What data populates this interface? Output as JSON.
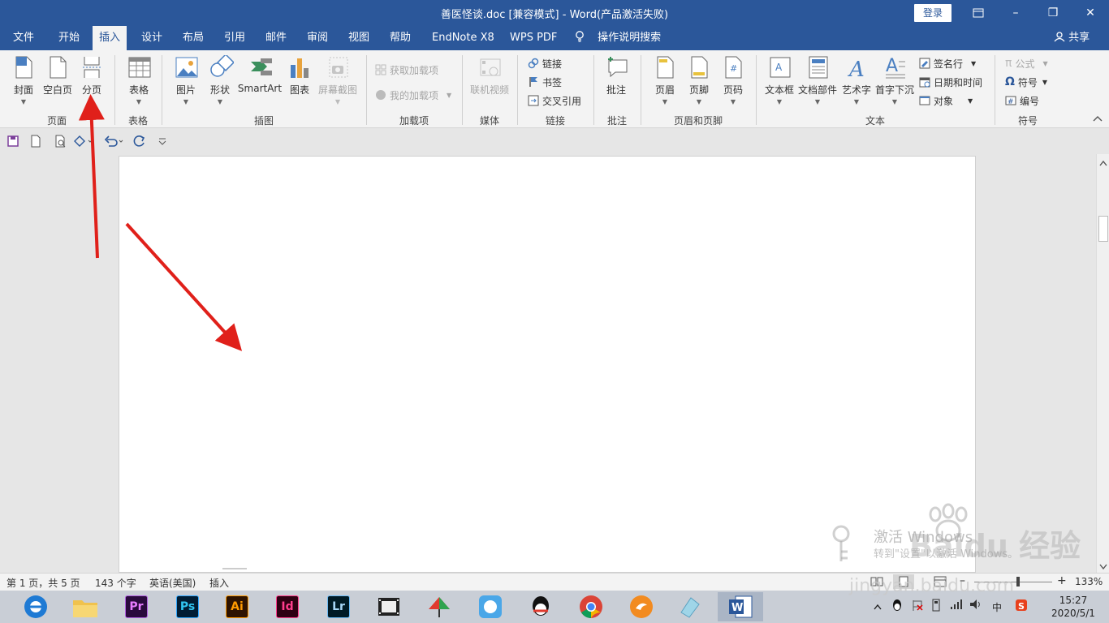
{
  "titlebar": {
    "title": "善医怪谈.doc [兼容模式]  -  Word(产品激活失败)",
    "login": "登录",
    "ribbon_display_icon": "ribbon-display-icon",
    "minimize": "–",
    "restore": "❐",
    "close": "✕"
  },
  "menu": {
    "tabs": [
      "文件",
      "开始",
      "插入",
      "设计",
      "布局",
      "引用",
      "邮件",
      "审阅",
      "视图",
      "帮助",
      "EndNote X8",
      "WPS PDF"
    ],
    "active": "插入",
    "search": "操作说明搜索",
    "share": "共享"
  },
  "ribbon": {
    "pages": {
      "cover": "封面",
      "blank": "空白页",
      "break": "分页",
      "label": "页面"
    },
    "tables": {
      "table": "表格",
      "label": "表格"
    },
    "illustrations": {
      "picture": "图片",
      "shapes": "形状",
      "smartart": "SmartArt",
      "chart": "图表",
      "screenshot": "屏幕截图",
      "label": "插图"
    },
    "addins": {
      "get": "获取加载项",
      "mine": "我的加载项",
      "label": "加载项"
    },
    "media": {
      "video": "联机视频",
      "label": "媒体"
    },
    "links": {
      "link": "链接",
      "bookmark": "书签",
      "crossref": "交叉引用",
      "label": "链接"
    },
    "comments": {
      "comment": "批注",
      "label": "批注"
    },
    "header_footer": {
      "header": "页眉",
      "footer": "页脚",
      "page_number": "页码",
      "label": "页眉和页脚"
    },
    "text": {
      "textbox": "文本框",
      "quickparts": "文档部件",
      "wordart": "艺术字",
      "dropcap": "首字下沉",
      "signature": "签名行",
      "datetime": "日期和时间",
      "object": "对象",
      "label": "文本"
    },
    "symbols": {
      "equation": "公式",
      "symbol": "符号",
      "number": "编号",
      "label": "符号"
    }
  },
  "statusbar": {
    "page": "第 1 页，共 5 页",
    "words": "143 个字",
    "language": "英语(美国)",
    "mode": "插入",
    "zoom": "133%"
  },
  "taskbar": {
    "apps": [
      "Pr",
      "Ps",
      "Ai",
      "Id",
      "Lr"
    ],
    "ime": "中",
    "time": "15:27",
    "date": "2020/5/1"
  },
  "watermark": {
    "activate": "激活 Windows",
    "activate_sub": "转到\"设置\"以激活 Windows。",
    "site": "jingyan.baidu.com",
    "brand": "Baidu 经验"
  },
  "colors": {
    "accent": "#2b579a",
    "arrow": "#e0201a"
  }
}
